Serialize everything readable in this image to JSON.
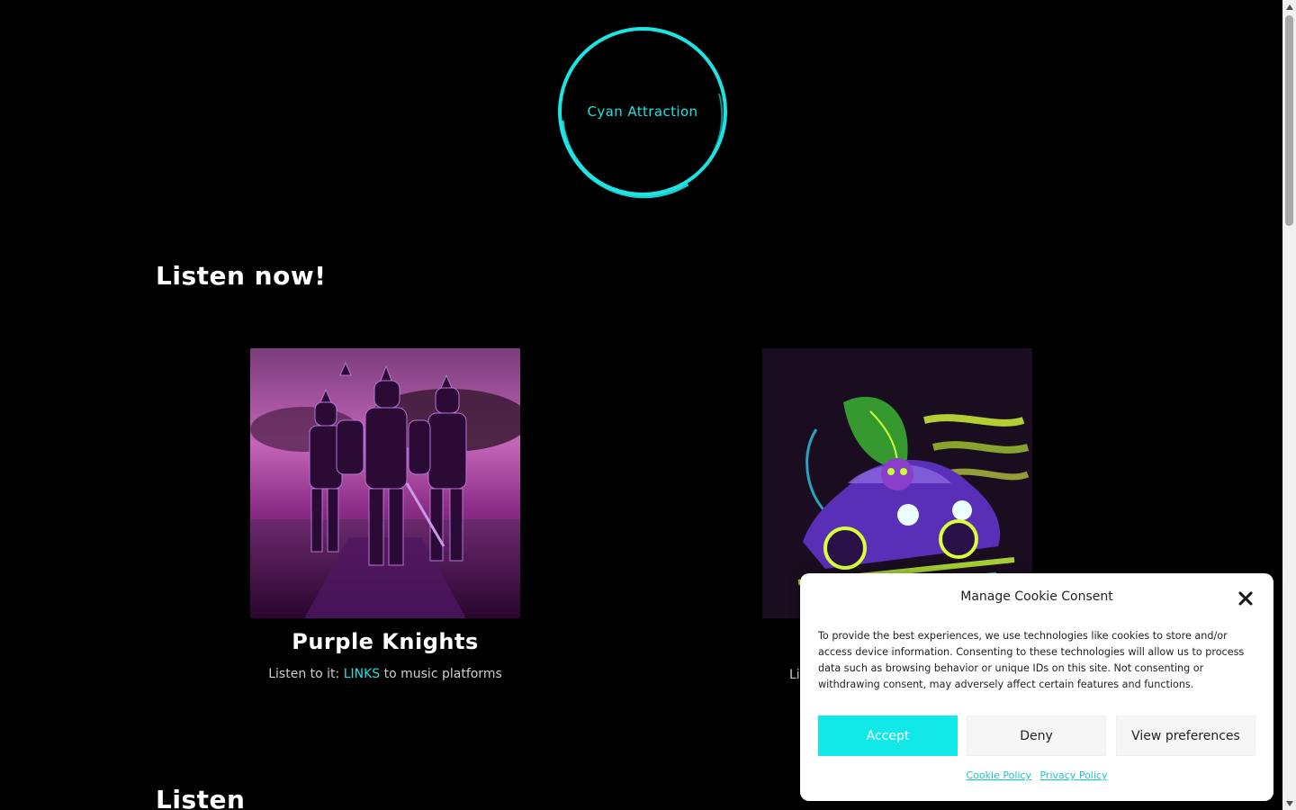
{
  "brand": {
    "logo_text": "Cyan Attraction",
    "accent_color": "#1ee3e3"
  },
  "sections": {
    "listen_now_title": "Listen now!",
    "listen_title": "Listen"
  },
  "releases": [
    {
      "title": "Purple Knights",
      "sub_prefix": "Listen to it:",
      "link_label": "LINKS",
      "sub_suffix": "to music platforms",
      "cover_icon": "purple-knights-cover"
    },
    {
      "title": "",
      "sub_prefix": "Li",
      "link_label": "",
      "sub_suffix": "",
      "cover_icon": "neon-car-cover"
    }
  ],
  "cookie": {
    "title": "Manage Cookie Consent",
    "body": "To provide the best experiences, we use technologies like cookies to store and/or access device information. Consenting to these technologies will allow us to process data such as browsing behavior or unique IDs on this site. Not consenting or withdrawing consent, may adversely affect certain features and functions.",
    "accept_label": "Accept",
    "deny_label": "Deny",
    "prefs_label": "View preferences",
    "cookie_policy_label": "Cookie Policy",
    "privacy_policy_label": "Privacy Policy",
    "accept_color": "#13e8e8"
  }
}
